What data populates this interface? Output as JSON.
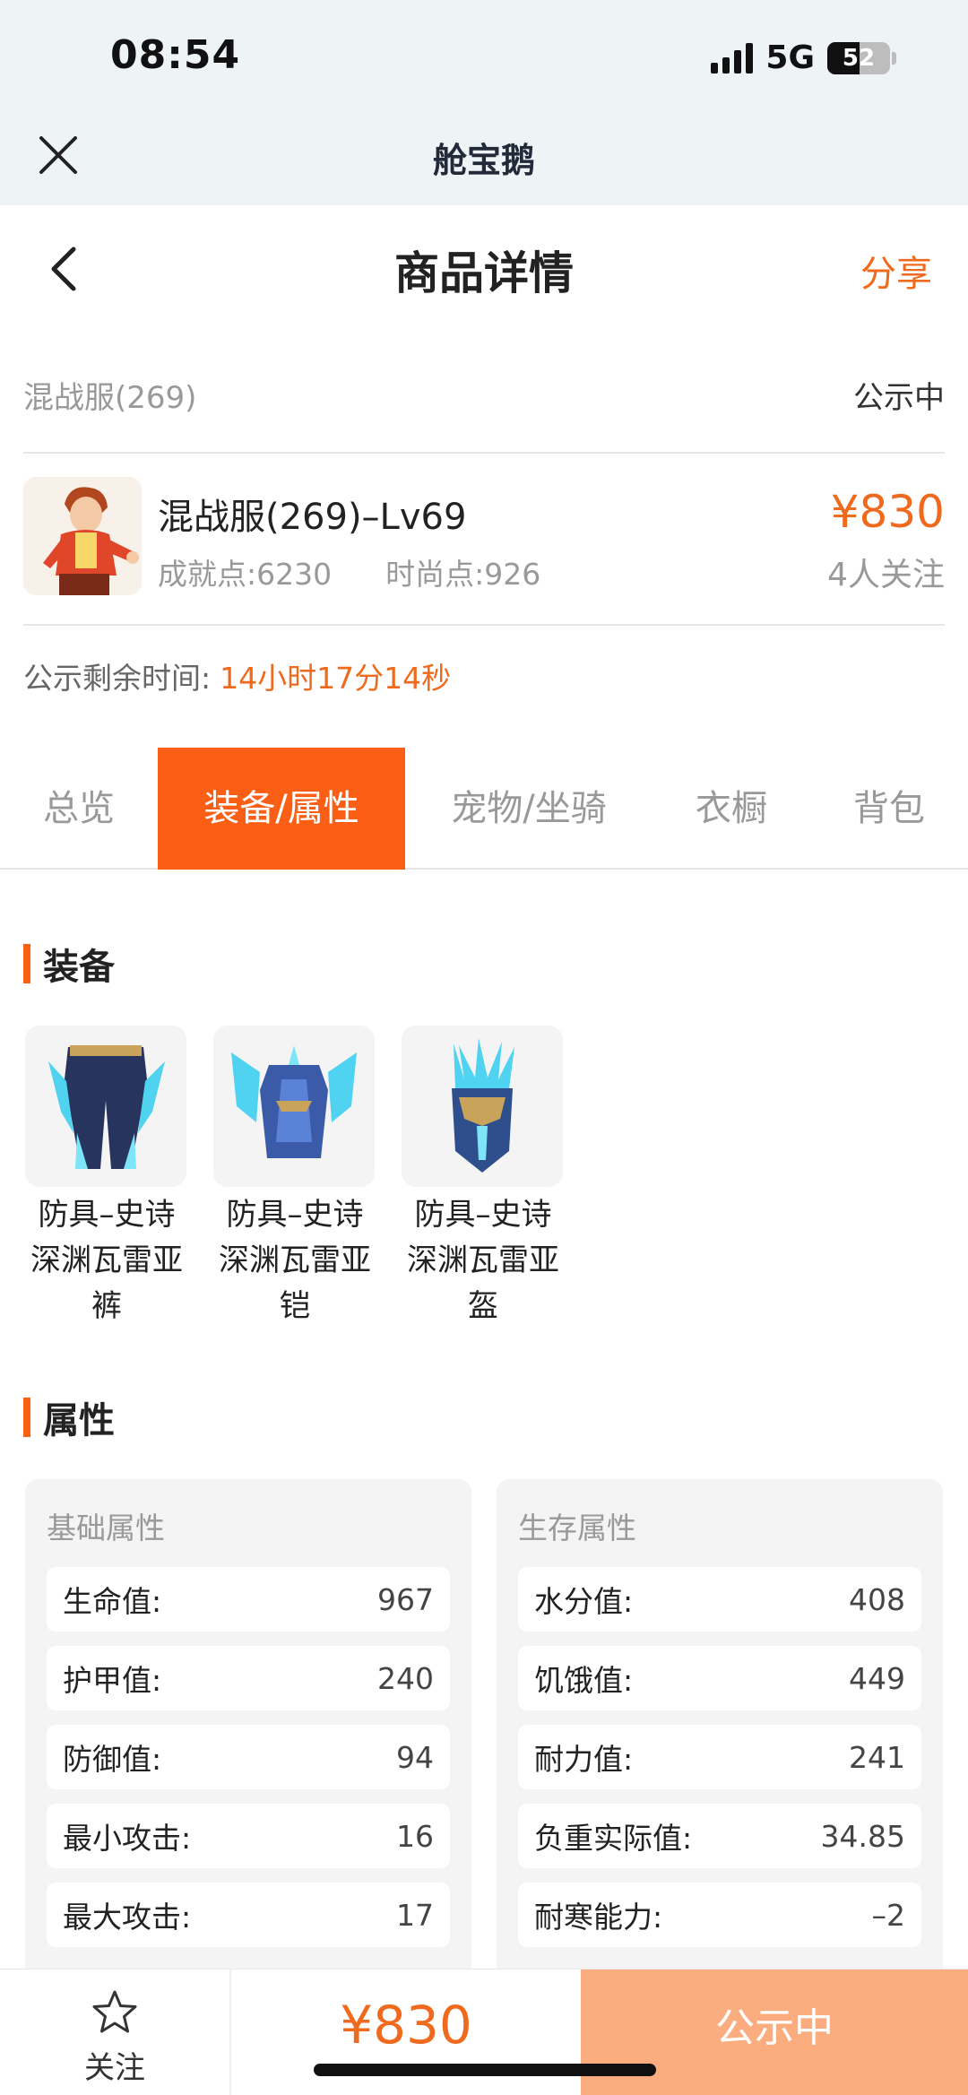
{
  "status": {
    "time": "08:54",
    "network": "5G",
    "battery": "52",
    "battery_level": 0.52
  },
  "app": {
    "title": "舱宝鹅",
    "close_icon": "close-icon"
  },
  "header": {
    "title": "商品详情",
    "share": "分享",
    "back_icon": "chevron-left-icon"
  },
  "server": {
    "name": "混战服(269)",
    "status": "公示中"
  },
  "product": {
    "name": "混战服(269)–Lv69",
    "achievement": "成就点:6230",
    "fashion": "时尚点:926",
    "price": "¥830",
    "watchers": "4人关注"
  },
  "remaining": {
    "label": "公示剩余时间:",
    "value": "14小时17分14秒"
  },
  "tabs": [
    {
      "label": "总览",
      "active": false
    },
    {
      "label": "装备/属性",
      "active": true
    },
    {
      "label": "宠物/坐骑",
      "active": false
    },
    {
      "label": "衣橱",
      "active": false
    },
    {
      "label": "背包",
      "active": false
    }
  ],
  "equipment": {
    "title": "装备",
    "items": [
      {
        "line1": "防具–史诗",
        "line2": "深渊瓦雷亚",
        "line3": "裤",
        "icon": "pants-icon"
      },
      {
        "line1": "防具–史诗",
        "line2": "深渊瓦雷亚",
        "line3": "铠",
        "icon": "armor-icon"
      },
      {
        "line1": "防具–史诗",
        "line2": "深渊瓦雷亚",
        "line3": "盔",
        "icon": "helmet-icon"
      }
    ]
  },
  "attributes": {
    "title": "属性",
    "basic": {
      "title": "基础属性",
      "rows": [
        {
          "label": "生命值:",
          "value": "967"
        },
        {
          "label": "护甲值:",
          "value": "240"
        },
        {
          "label": "防御值:",
          "value": "94"
        },
        {
          "label": "最小攻击:",
          "value": "16"
        },
        {
          "label": "最大攻击:",
          "value": "17"
        }
      ]
    },
    "survival": {
      "title": "生存属性",
      "rows": [
        {
          "label": "水分值:",
          "value": "408"
        },
        {
          "label": "饥饿值:",
          "value": "449"
        },
        {
          "label": "耐力值:",
          "value": "241"
        },
        {
          "label": "负重实际值:",
          "value": "34.85"
        },
        {
          "label": "耐寒能力:",
          "value": "–2"
        }
      ]
    }
  },
  "bottom": {
    "follow": "关注",
    "price": "¥830",
    "action": "公示中"
  },
  "colors": {
    "accent": "#fa5f15",
    "price": "#f06a1d",
    "action_bg": "#fbad80"
  }
}
